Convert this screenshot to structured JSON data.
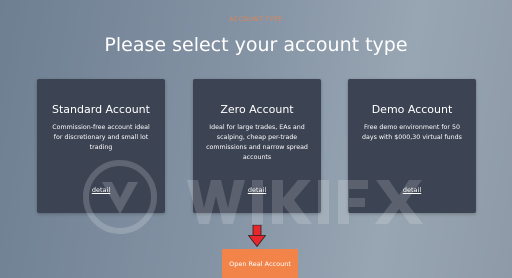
{
  "header": {
    "eyebrow": "ACCOUNT TYPE",
    "title": "Please select your account type"
  },
  "accounts": [
    {
      "name": "Standard Account",
      "description": "Commission-free account ideal for discretionary and small lot trading",
      "detail_label": "detail"
    },
    {
      "name": "Zero Account",
      "description": "Ideal for large trades, EAs and scalping, cheap per-trade commissions and narrow spread accounts",
      "detail_label": "detail"
    },
    {
      "name": "Demo Account",
      "description": "Free demo environment for 50 days with $000,30 virtual funds",
      "detail_label": "detail"
    }
  ],
  "cta": {
    "label": "Open Real Account"
  },
  "icons": {
    "pointer": "red-down-arrow-icon",
    "watermark": "wikifx-watermark"
  },
  "colors": {
    "accent": "#f2844a",
    "card_bg": "#3c4353",
    "pointer": "#e8262b"
  }
}
